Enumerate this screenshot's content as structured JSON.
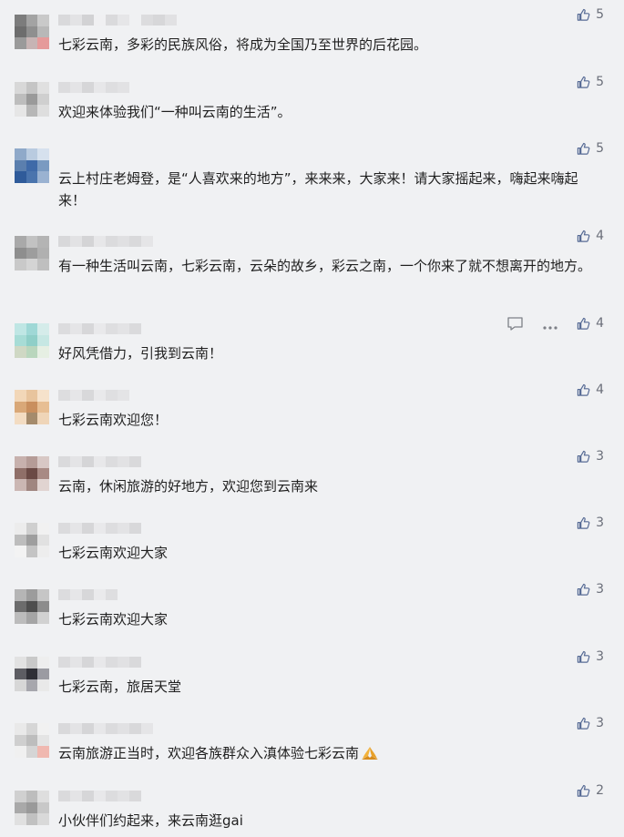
{
  "comments": [
    {
      "text": "七彩云南，多彩的民族风俗，将成为全国乃至世界的后花园。",
      "likes": "5",
      "avatar": [
        "#7c7c7c",
        "#a3a3a3",
        "#c9c9c9",
        "#6d6d6d",
        "#8f8f8f",
        "#b8b8b8",
        "#9a9a9a",
        "#c7b4b4",
        "#e59a9a"
      ],
      "name": [
        "#d9d9db",
        "#e3e3e5",
        "#d2d2d4",
        "#f0f0f2",
        "#dadadc",
        "#e6e6e8",
        "#f0f1f3",
        "#dcdcde",
        "#d7d7d9",
        "#e1e1e3"
      ]
    },
    {
      "text": "欢迎来体验我们“一种叫云南的生活”。",
      "likes": "5",
      "avatar": [
        "#d8d8d8",
        "#c5c5c5",
        "#e0e0e0",
        "#bdbdbd",
        "#9a9a9a",
        "#cfcfcf",
        "#e6e6e6",
        "#b7b7b7",
        "#dedede"
      ],
      "name": [
        "#dcdcde",
        "#e4e4e6",
        "#d6d6d8",
        "#e7e7e9",
        "#dedee0",
        "#e2e2e4"
      ]
    },
    {
      "text": "云上村庄老姆登，是“人喜欢来的地方”，来来来，大家来！请大家摇起来，嗨起来嗨起来！",
      "likes": "5",
      "avatar": [
        "#8fa9c9",
        "#b9cbe0",
        "#d6e1ee",
        "#5b7fae",
        "#3f6aa8",
        "#7a9ac1",
        "#2f5b9a",
        "#4a74ad",
        "#9ab2d1"
      ],
      "name": []
    },
    {
      "text": "有一种生活叫云南，七彩云南，云朵的故乡，彩云之南，一个你来了就不想离开的地方。",
      "likes": "4",
      "avatar": [
        "#a9a9a9",
        "#c2c2c2",
        "#b4b4b4",
        "#8e8e8e",
        "#9d9d9d",
        "#b0b0b0",
        "#c9c9c9",
        "#d4d4d4",
        "#bfbfbf"
      ],
      "name": [
        "#d8d8da",
        "#e2e2e4",
        "#d4d4d6",
        "#e7e7e9",
        "#dbdbdd",
        "#e0e0e2",
        "#d9d9db",
        "#e5e5e7"
      ]
    },
    {
      "text": "好风凭借力，引我到云南！",
      "likes": "4",
      "avatar": [
        "#bfe6e4",
        "#9fd8d6",
        "#d5ecea",
        "#a7dcd6",
        "#8fcfc8",
        "#c6e7e3",
        "#cfd8c4",
        "#b9d6bd",
        "#e6efe3"
      ],
      "name": [
        "#dcdcde",
        "#e5e5e7",
        "#d7d7d9",
        "#e9e9eb",
        "#dedee0",
        "#e3e3e5",
        "#dadadc"
      ]
    },
    {
      "text": "七彩云南欢迎您！",
      "likes": "4",
      "avatar": [
        "#f2d7b8",
        "#e8c49d",
        "#f6e2cb",
        "#d9a878",
        "#c98f5e",
        "#e7be93",
        "#f3dcc2",
        "#a58b6c",
        "#efd5b8"
      ],
      "name": [
        "#dddddf",
        "#e6e6e8",
        "#d8d8da",
        "#e9e9eb",
        "#dfdfe1",
        "#e4e4e6"
      ]
    },
    {
      "text": "云南，休闲旅游的好地方，欢迎您到云南来",
      "likes": "3",
      "avatar": [
        "#c7b1ad",
        "#b59c97",
        "#d8c8c5",
        "#8f6f68",
        "#6b4a45",
        "#a88a84",
        "#cbb7b3",
        "#a08680",
        "#e1d4d1"
      ],
      "name": [
        "#dadadc",
        "#e4e4e6",
        "#d5d5d7",
        "#e8e8ea",
        "#dcdcde",
        "#e2e2e4",
        "#d9d9db"
      ]
    },
    {
      "text": "七彩云南欢迎大家",
      "likes": "3",
      "avatar": [
        "#ececec",
        "#cfcfcf",
        "#f1f1f1",
        "#bdbdbd",
        "#9e9e9e",
        "#e1e1e1",
        "#f3f3f3",
        "#c4c4c4",
        "#ededed"
      ],
      "name": [
        "#dbdbdd",
        "#e5e5e7",
        "#d6d6d8",
        "#e9e9eb",
        "#dddddf",
        "#e3e3e5",
        "#d8d8da"
      ]
    },
    {
      "text": "七彩云南欢迎大家",
      "likes": "3",
      "avatar": [
        "#b5b5b5",
        "#9c9c9c",
        "#c6c6c6",
        "#6c6c6c",
        "#4e4e4e",
        "#8c8c8c",
        "#bcbcbc",
        "#a5a5a5",
        "#d1d1d1"
      ],
      "name": [
        "#dcdcde",
        "#e6e6e8",
        "#d7d7d9",
        "#eaeaec",
        "#dedee0"
      ]
    },
    {
      "text": "七彩云南，旅居天堂",
      "likes": "3",
      "avatar": [
        "#e2e2e2",
        "#c9c9c9",
        "#eeeeee",
        "#5d5d63",
        "#2f2f36",
        "#9b9ba2",
        "#d7d7d7",
        "#a7a7ad",
        "#e9e9e9"
      ],
      "name": [
        "#dbdbdd",
        "#e4e4e6",
        "#d6d6d8",
        "#e8e8ea",
        "#dcdcde",
        "#e1e1e3",
        "#d9d9db"
      ]
    },
    {
      "text": "云南旅游正当时，欢迎各族群众入滇体验七彩云南",
      "likes": "3",
      "avatar": [
        "#e9e9e9",
        "#d6d6d6",
        "#f1f1f1",
        "#cfcfcf",
        "#bdbdbd",
        "#e4e4e4",
        "#f0f0f0",
        "#d5d5d5",
        "#f0b8b0"
      ],
      "name": [
        "#d9d9db",
        "#e3e3e5",
        "#d5d5d7",
        "#e7e7e9",
        "#dbdbdd",
        "#e1e1e3",
        "#d8d8da",
        "#e5e5e7"
      ]
    },
    {
      "text": "小伙伴们约起来，来云南逛gai",
      "likes": "2",
      "avatar": [
        "#d0d0d0",
        "#bdbdbd",
        "#dedede",
        "#a9a9a9",
        "#9a9a9a",
        "#c8c8c8",
        "#e0e0e0",
        "#c1c1c1",
        "#d9d9d9"
      ],
      "name": [
        "#dadadc",
        "#e4e4e6",
        "#d6d6d8",
        "#e8e8ea",
        "#dcdcde",
        "#e2e2e4",
        "#d9d9db"
      ]
    }
  ],
  "icons": {
    "like": "thumbs-up-icon",
    "reply": "speech-bubble-icon",
    "more": "ellipsis-icon",
    "emoji": "praying-hands-emoji"
  },
  "colors": {
    "background": "#f0f1f3",
    "text": "#1f1f1f",
    "like_icon": "#576b95",
    "like_count": "#6b6f7a"
  }
}
